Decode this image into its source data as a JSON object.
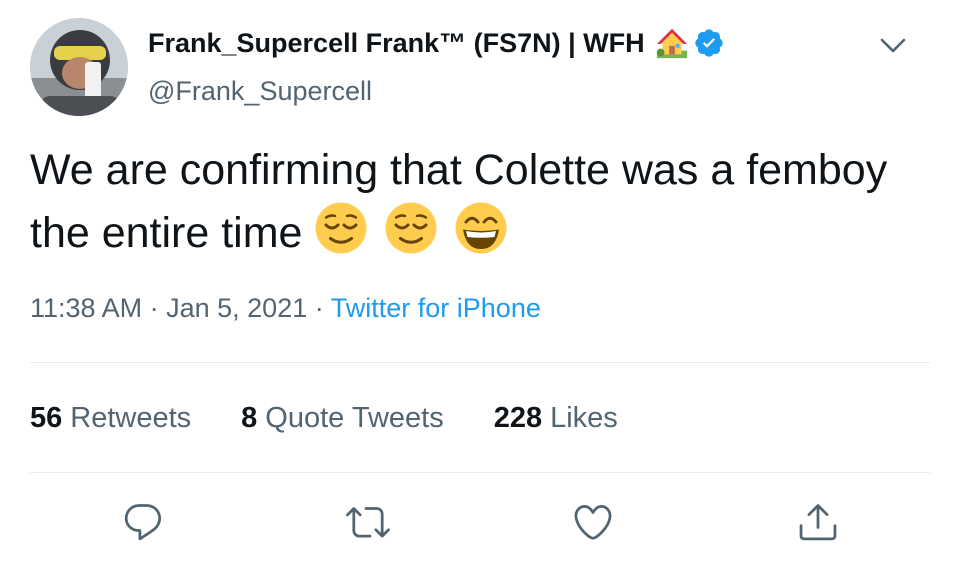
{
  "author": {
    "name": "Frank_Supercell Frank™ (FS7N) | WFH",
    "handle": "@Frank_Supercell",
    "avatar_icon": "user-avatar-photo",
    "house_icon": "house-with-garden-emoji",
    "verified_icon": "verified-badge"
  },
  "tweet": {
    "text": "We are confirming that Colette was a femboy the entire time",
    "emojis": [
      "relieved-face-emoji",
      "relieved-face-emoji",
      "grinning-face-emoji"
    ]
  },
  "meta": {
    "time": "11:38 AM",
    "separator": "·",
    "date": "Jan 5, 2021",
    "source": "Twitter for iPhone"
  },
  "stats": {
    "retweets_count": "56",
    "retweets_label": "Retweets",
    "quotes_count": "8",
    "quotes_label": "Quote Tweets",
    "likes_count": "228",
    "likes_label": "Likes"
  },
  "actions": {
    "reply_icon": "reply-icon",
    "retweet_icon": "retweet-icon",
    "like_icon": "like-icon",
    "share_icon": "share-icon"
  },
  "colors": {
    "text_primary": "#0f1419",
    "text_secondary": "#536471",
    "link": "#1d9bf0",
    "verified": "#1d9bf0",
    "divider": "#e6ecf0"
  }
}
